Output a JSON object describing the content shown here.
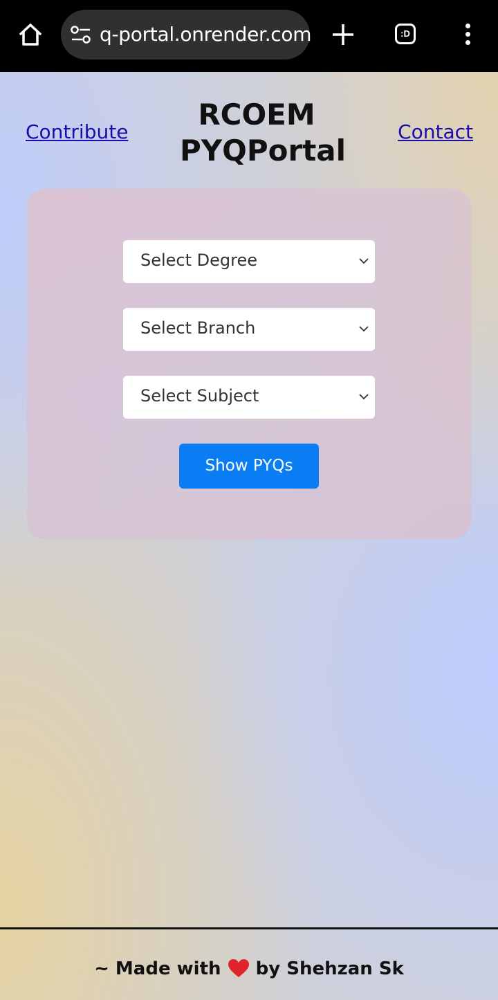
{
  "browser": {
    "url": "q-portal.onrender.com",
    "tab_badge": ":D",
    "icons": [
      "home-icon",
      "site-settings-icon",
      "new-tab-plus-icon",
      "tab-switcher-icon",
      "overflow-menu-icon"
    ]
  },
  "header": {
    "contribute_label": "Contribute",
    "title_line1": "RCOEM",
    "title_line2": "PYQPortal",
    "contact_label": "Contact"
  },
  "form": {
    "degree_selected": "Select Degree",
    "branch_selected": "Select Branch",
    "subject_selected": "Select Subject",
    "submit_label": "Show PYQs"
  },
  "footer": {
    "prefix": "~ Made with",
    "suffix": "by Shehzan Sk"
  },
  "colors": {
    "accent": "#0a7cf4",
    "link": "#1a0dab",
    "heart": "#e0242b"
  }
}
